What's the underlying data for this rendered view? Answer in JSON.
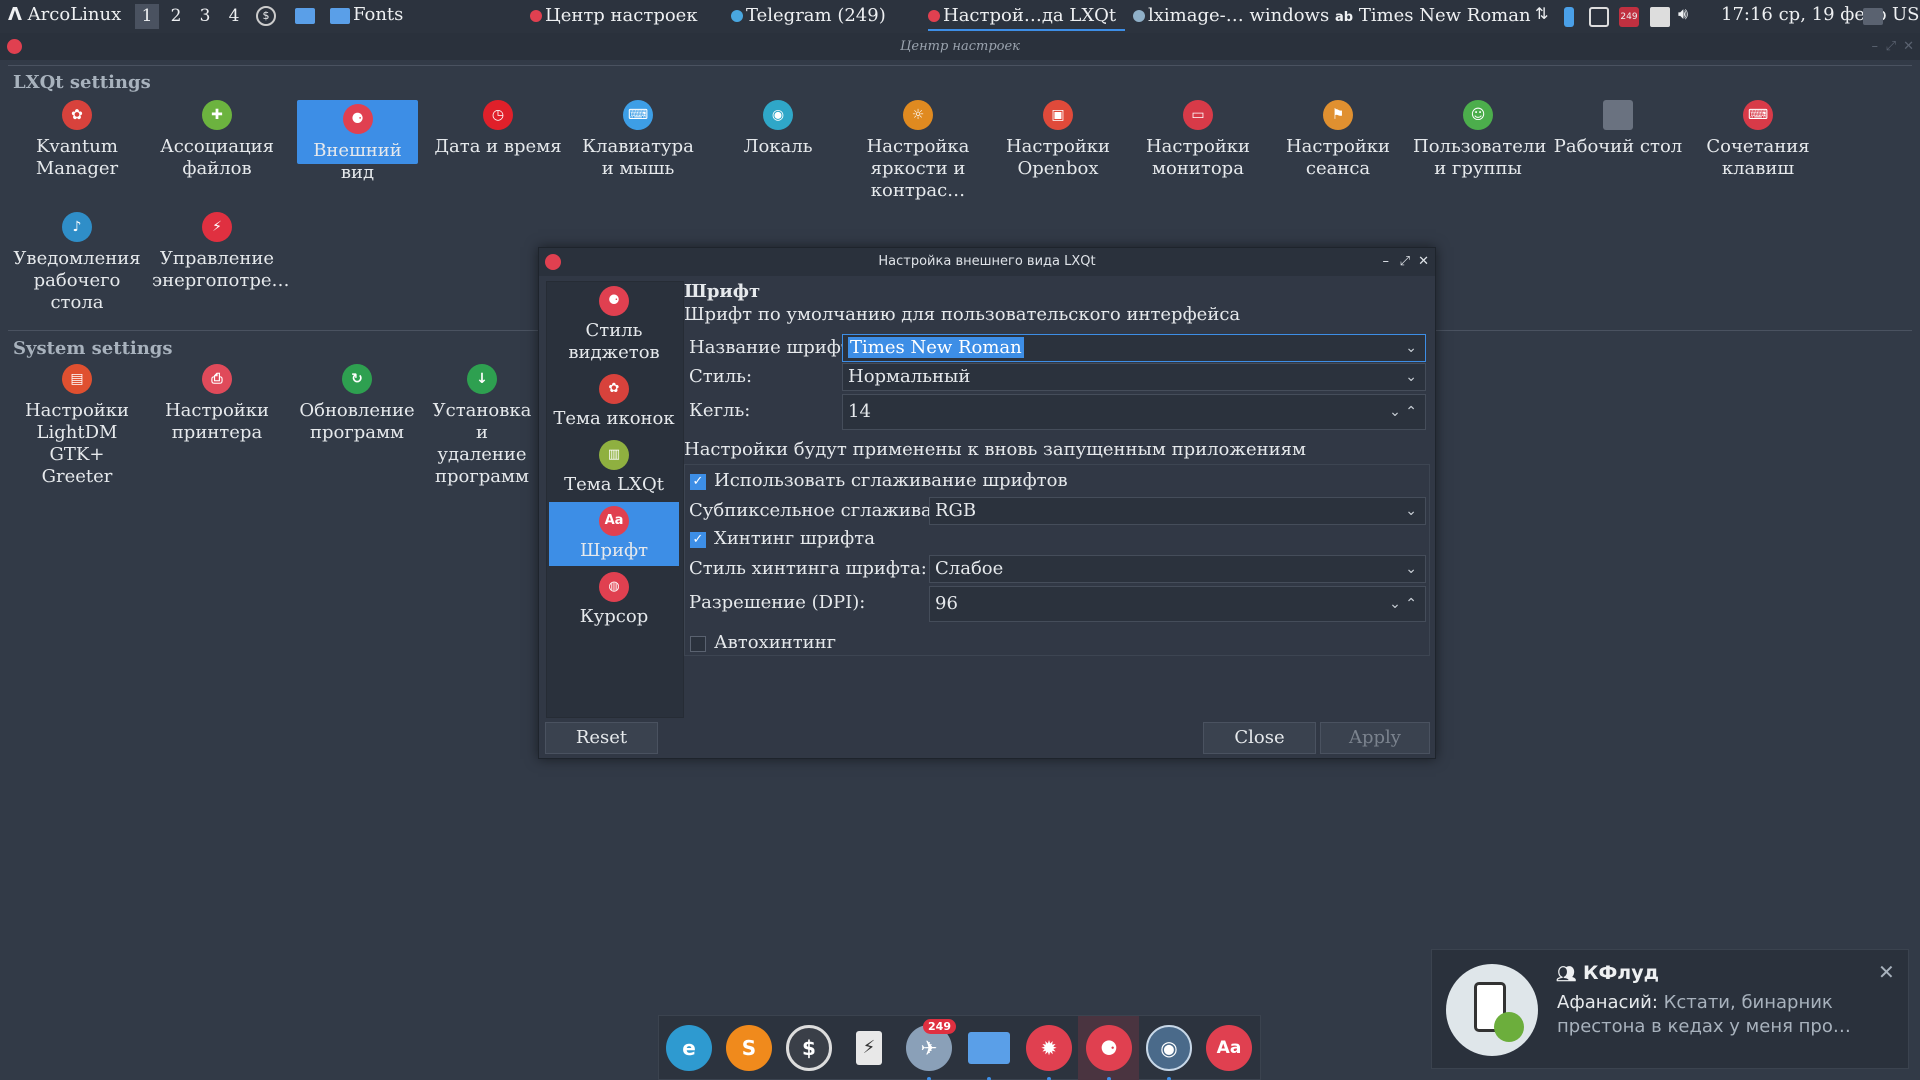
{
  "panel": {
    "distro": "ArcoLinux",
    "workspaces": [
      "1",
      "2",
      "3",
      "4"
    ],
    "fonts_label": "Fonts",
    "tasks": [
      "Центр настроек",
      "Telegram (249)",
      "Настрой…да LXQt",
      "lximage-… windows",
      "Times New Roman"
    ],
    "tray_badge": "249",
    "clock": "17:16 ср, 19 февр",
    "layout": "US"
  },
  "window": {
    "title": "Центр настроек"
  },
  "lxqt": {
    "header": "LXQt settings",
    "items": [
      "Kvantum Manager",
      "Ассоциация файлов",
      "Внешний вид",
      "Дата и время",
      "Клавиатура и мышь",
      "Локаль",
      "Настройка яркости и контрас…",
      "Настройки Openbox",
      "Настройки монитора",
      "Настройки сеанса",
      "Пользователи и группы",
      "Рабочий стол",
      "Сочетания клавиш",
      "Уведомления рабочего стола",
      "Управление энергопотре…"
    ]
  },
  "system": {
    "header": "System settings",
    "items": [
      "Настройки LightDM GTK+ Greeter",
      "Настройки принтера",
      "Обновление программ",
      "Установка и удаление программ"
    ]
  },
  "dialog": {
    "title": "Настройка внешнего вида LXQt",
    "side": [
      "Стиль виджетов",
      "Тема иконок",
      "Тема LXQt",
      "Шрифт",
      "Курсор"
    ],
    "heading": "Шрифт",
    "subtitle": "Шрифт по умолчанию для пользовательского интерфейса",
    "font_name_label": "Название шрифта:",
    "font_name_value": "Times New Roman",
    "style_label": "Стиль:",
    "style_value": "Нормальный",
    "size_label": "Кегль:",
    "size_value": "14",
    "notice": "Настройки будут применены к вновь запущенным приложениям",
    "antialias_label": "Использовать сглаживание шрифтов",
    "subpixel_label": "Субпиксельное сглаживание:",
    "subpixel_value": "RGB",
    "hinting_label": "Хинтинг шрифта",
    "hint_style_label": "Стиль хинтинга шрифта:",
    "hint_style_value": "Слабое",
    "dpi_label": "Разрешение (DPI):",
    "dpi_value": "96",
    "autohint_label": "Автохинтинг",
    "reset": "Reset",
    "close": "Close",
    "apply": "Apply"
  },
  "dock": {
    "telegram_badge": "249"
  },
  "notification": {
    "chat": "КФлуд",
    "sender": "Афанасий:",
    "text_line1": "Кстати, бинарник",
    "text_line2": "престона в кедах у меня про…"
  },
  "colors": {
    "accent": "#3d8ee6",
    "bg": "#323a47"
  }
}
